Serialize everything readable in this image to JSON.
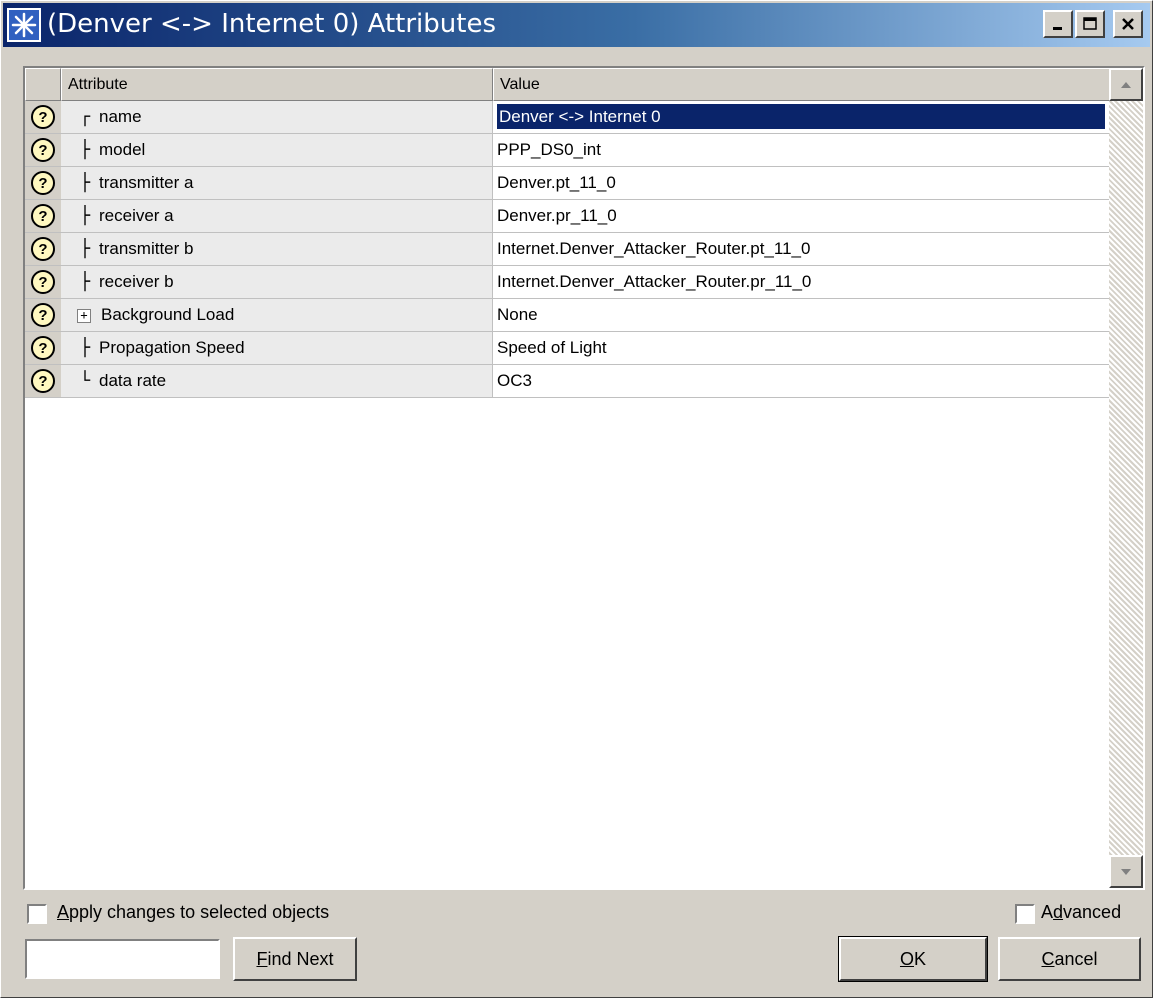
{
  "window": {
    "title": "(Denver <-> Internet 0) Attributes",
    "icon": "asterisk-app-icon",
    "controls": {
      "minimize": "_",
      "maximize": "□",
      "close": "x"
    }
  },
  "table": {
    "columns": {
      "attribute": "Attribute",
      "value": "Value"
    },
    "help_glyph": "?",
    "rows": [
      {
        "tree": "┌",
        "attribute": "name",
        "value": "Denver <-> Internet 0",
        "selected": true
      },
      {
        "tree": "├",
        "attribute": "model",
        "value": "PPP_DS0_int"
      },
      {
        "tree": "├",
        "attribute": "transmitter a",
        "value": "Denver.pt_11_0"
      },
      {
        "tree": "├",
        "attribute": "receiver a",
        "value": "Denver.pr_11_0"
      },
      {
        "tree": "├",
        "attribute": "transmitter b",
        "value": "Internet.Denver_Attacker_Router.pt_11_0"
      },
      {
        "tree": "├",
        "attribute": "receiver b",
        "value": "Internet.Denver_Attacker_Router.pr_11_0"
      },
      {
        "tree": "+",
        "attribute": "Background Load",
        "value": "None",
        "expandable": true
      },
      {
        "tree": "├",
        "attribute": "Propagation Speed",
        "value": "Speed of Light"
      },
      {
        "tree": "└",
        "attribute": "data rate",
        "value": "OC3"
      }
    ]
  },
  "footer": {
    "apply_changes": {
      "prefix": "",
      "accel": "A",
      "rest": "pply changes to selected objects",
      "checked": false
    },
    "advanced": {
      "prefix": "A",
      "accel": "d",
      "rest": "vanced",
      "checked": false
    },
    "find_input": {
      "value": ""
    },
    "find_next": {
      "accel": "F",
      "rest": "ind Next"
    },
    "ok": {
      "accel": "O",
      "rest": "K"
    },
    "cancel": {
      "accel": "C",
      "rest": "ancel"
    }
  }
}
